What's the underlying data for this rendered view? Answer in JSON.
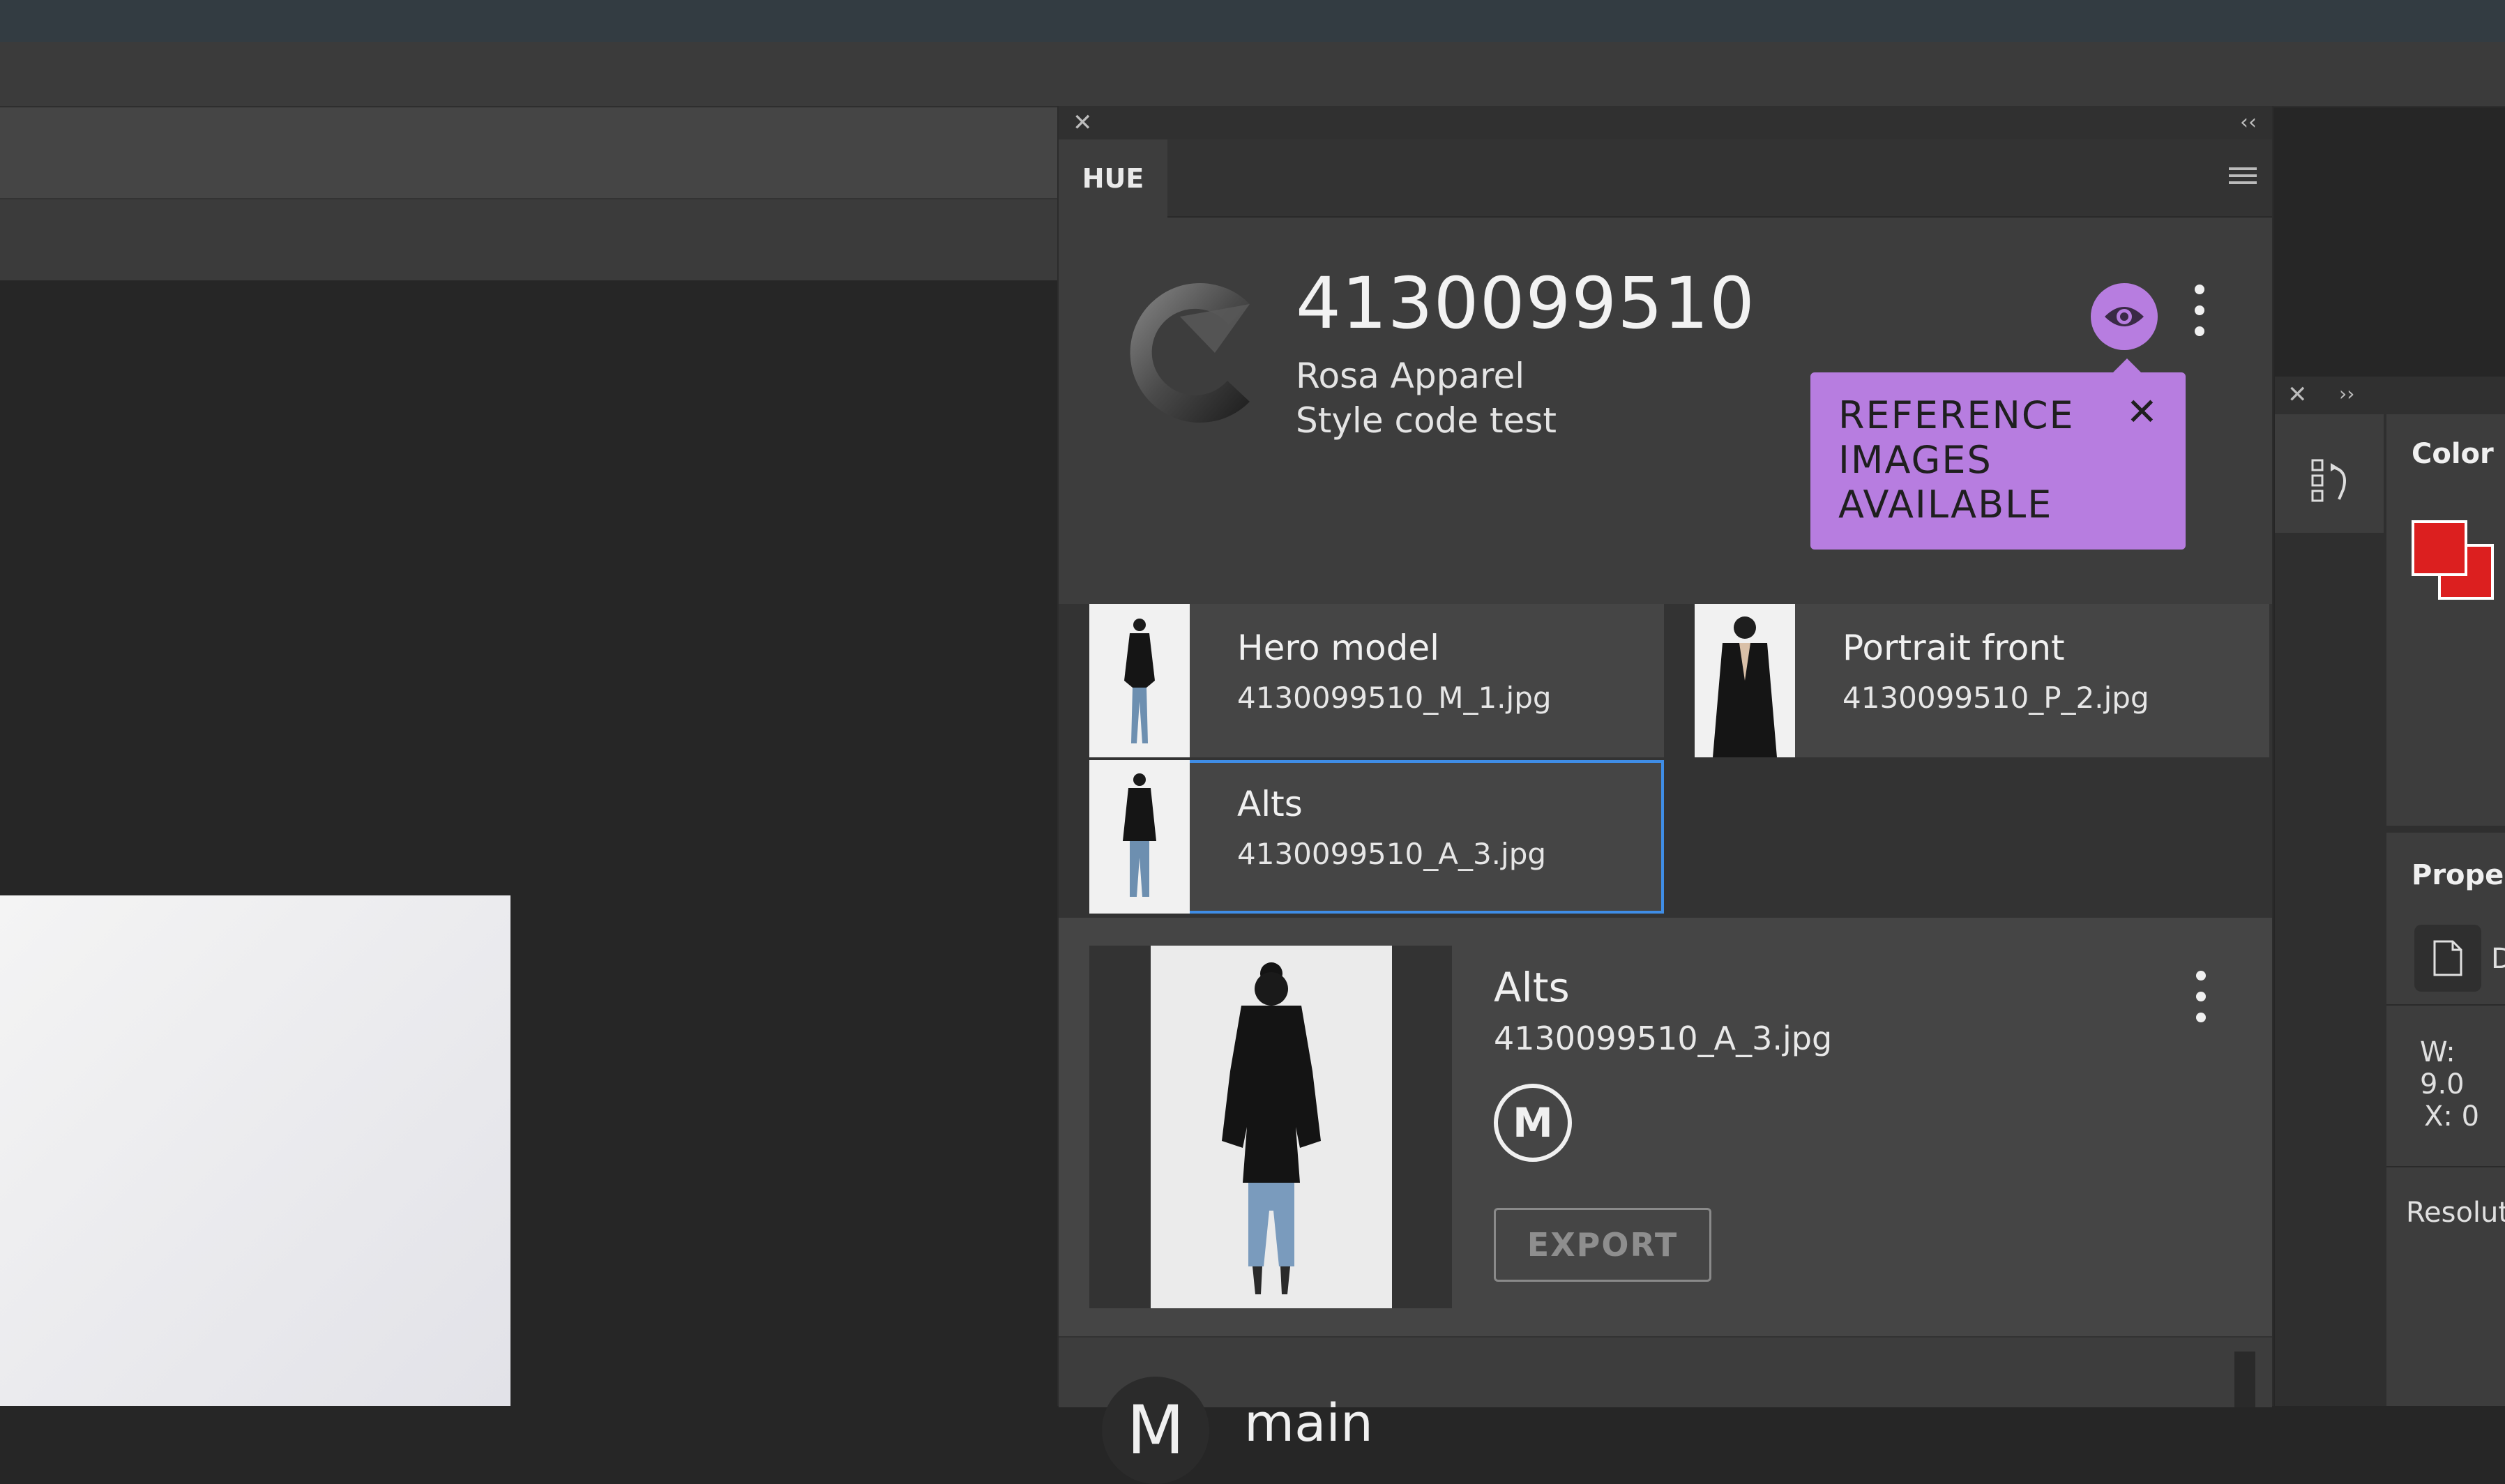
{
  "hue_panel": {
    "close_glyph": "✕",
    "collapse_glyph": "‹‹",
    "tab_label": "HUE",
    "header": {
      "style_code": "4130099510",
      "brand": "Rosa Apparel",
      "subtitle": "Style code test"
    },
    "tooltip": {
      "text": "REFERENCE IMAGES AVAILABLE",
      "close_glyph": "✕",
      "color": "#b77de0"
    },
    "thumbnails": [
      {
        "title": "Hero model",
        "filename": "4130099510_M_1.jpg",
        "selected": false
      },
      {
        "title": "Portrait front",
        "filename": "4130099510_P_2.jpg",
        "selected": false
      },
      {
        "title": "Alts",
        "filename": "4130099510_A_3.jpg",
        "selected": true
      }
    ],
    "detail": {
      "title": "Alts",
      "filename": "4130099510_A_3.jpg",
      "badge": "M",
      "export_label": "EXPORT"
    },
    "branch": {
      "avatar": "M",
      "name": "main"
    }
  },
  "right_panel": {
    "close_glyph": "✕",
    "expand_glyph": "››",
    "color_label": "Color",
    "swatch_color": "#dc1f1f",
    "properties_label": "Proper",
    "doc_trailing": "D",
    "w_label": "W: 9.0",
    "x_label": "X: 0",
    "resolution_label": "Resolut"
  },
  "colors": {
    "accent": "#b77de0",
    "selection": "#3f8de6"
  }
}
